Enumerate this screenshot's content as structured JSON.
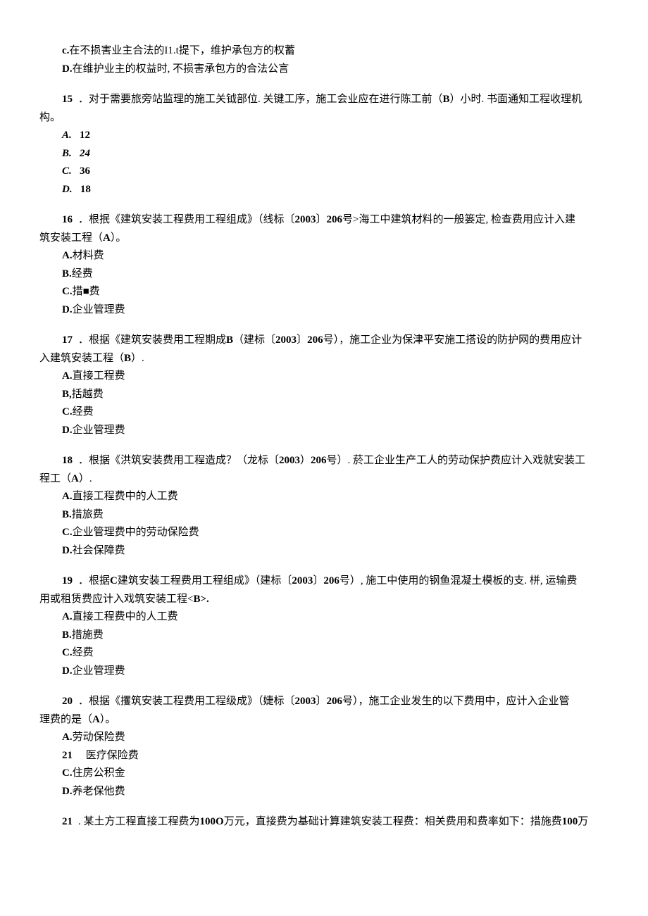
{
  "q14tail": {
    "c": "c.",
    "c_text": "在不损害业主合法的I1.t提下，维护承包方的权蓄",
    "d": "D.",
    "d_text": "在维护业主的权益时, 不损害承包方的合法公言"
  },
  "q15": {
    "num": "15",
    "text_a": "．对于需要旅旁站监理的施工关钺部位. 关键工序，施工会业应在进行陈工前（",
    "ans": "B",
    "text_b": "）小时. 书面通知工程收理机",
    "tail": "构。",
    "opts": {
      "a_l": "A.",
      "a_v": "12",
      "b_l": "B.",
      "b_v": "24",
      "c_l": "C.",
      "c_v": "36",
      "d_l": "D.",
      "d_v": "18"
    }
  },
  "q16": {
    "num": "16",
    "text_a": "．根抿《建筑安装工程费用工程组成》（线标〔",
    "bold1": "2003",
    "text_b": "〕",
    "bold2": "206",
    "text_c": "号>海工中建筑材料的一般篓定, 检查费用应计入建",
    "tail": "筑安装工程（",
    "ans": "A",
    "tail2": "）。",
    "opts": {
      "a": "A.",
      "a_text": "材料费",
      "b": "B.",
      "b_text": "经费",
      "c": "C.",
      "c_text": "措■费",
      "d": "D.",
      "d_text": "企业管理费"
    }
  },
  "q17": {
    "num": "17",
    "text_a": "．根据《建筑安装费用工程期成",
    "boldB": "B",
    "text_b": "（建标〔",
    "bold1": "2003",
    "text_c": "〕",
    "bold2": "206",
    "text_d": "号），施工企业为保津平安施工搭设的防护网的费用应计",
    "tail": "入建筑安装工程（",
    "ans": "B",
    "tail2": "）.",
    "opts": {
      "a": "A.",
      "a_text": "直接工程费",
      "b": "B,",
      "b_text": "括越费",
      "c": "C.",
      "c_text": "经费",
      "d": "D.",
      "d_text": "企业管理费"
    }
  },
  "q18": {
    "num": "18",
    "text_a": "．根据《洪筑安装费用工程造成？（龙标〔",
    "bold1": "2003",
    "text_b": "）",
    "bold2": "206",
    "text_c": "号）. 菸工企业生产工人的劳动保护费应计入戏就安装工",
    "tail": "程工（",
    "ans": "A",
    "tail2": "）.",
    "opts": {
      "a": "A.",
      "a_text": "直接工程费中的人工费",
      "b": "B.",
      "b_text": "措旅费",
      "c": "C.",
      "c_text": "企业管理费中的劳动保险费",
      "d": "D.",
      "d_text": "社会保障费"
    }
  },
  "q19": {
    "num": "19",
    "text_a": "．根据",
    "boldC": "C",
    "text_b": "建筑安装工程费用工程组成》（建标〔",
    "bold1": "2003",
    "text_c": "〕",
    "bold2": "206",
    "text_d": "号）, 施工中使用的钢鱼混凝土模板的支. 栟, 运输费",
    "tail": "用或租赁费应计入戏筑安装工程<",
    "ans": "B>.",
    "opts": {
      "a": "A.",
      "a_text": "直接工程费中的人工费",
      "b": "B.",
      "b_text": "措施费",
      "c": "C.",
      "c_text": "经费",
      "d": "D.",
      "d_text": "企业管理费"
    }
  },
  "q20": {
    "num": "20",
    "text_a": "．根据《攫筑安装工程费用工程级成》（婕标〔",
    "bold1": "2003",
    "text_b": "〕",
    "bold2": "206",
    "text_c": "号），施工企业发生的以下费用中，应计入企业管",
    "tail": "理费的是（",
    "ans": "A",
    "tail2": "）。",
    "opts": {
      "a": "A.",
      "a_text": "劳动保险费",
      "b_num": "21",
      "b_text": "医疗保险费",
      "c": "C.",
      "c_text": "住房公积金",
      "d": "D.",
      "d_text": "养老保他费"
    }
  },
  "q21": {
    "num": "21",
    "text_a": ". 某土方工程直接工程费为",
    "bold1": "100O",
    "text_b": "万元，直接费为基础计算建筑安装工程费：相关费用和费率如下：措施费",
    "bold2": "100",
    "text_c": "万"
  }
}
